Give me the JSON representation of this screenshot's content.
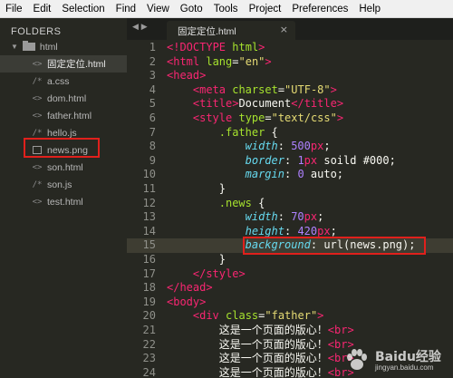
{
  "menu": [
    "File",
    "Edit",
    "Selection",
    "Find",
    "View",
    "Goto",
    "Tools",
    "Project",
    "Preferences",
    "Help"
  ],
  "sidebar": {
    "header": "FOLDERS",
    "folder": "html",
    "files": [
      {
        "icon": "<>",
        "name": "固定定位.html",
        "active": true
      },
      {
        "icon": "/*",
        "name": "a.css"
      },
      {
        "icon": "<>",
        "name": "dom.html"
      },
      {
        "icon": "<>",
        "name": "father.html"
      },
      {
        "icon": "/*",
        "name": "hello.js"
      },
      {
        "icon": "img",
        "name": "news.png",
        "highlighted": true
      },
      {
        "icon": "<>",
        "name": "son.html"
      },
      {
        "icon": "/*",
        "name": "son.js"
      },
      {
        "icon": "<>",
        "name": "test.html"
      }
    ]
  },
  "tab": {
    "title": "固定定位.html",
    "close": "×",
    "nav": "◀ ▶"
  },
  "editor": {
    "current_line": 15,
    "highlighted_line": 15,
    "lines": [
      {
        "n": "1",
        "indent": 0,
        "t": [
          [
            "tag",
            "<!"
          ],
          [
            "kw",
            "DOCTYPE"
          ],
          [
            "plain",
            " "
          ],
          [
            "attr",
            "html"
          ],
          [
            "tag",
            ">"
          ]
        ]
      },
      {
        "n": "2",
        "indent": 0,
        "t": [
          [
            "tag",
            "<html"
          ],
          [
            "plain",
            " "
          ],
          [
            "attr",
            "lang"
          ],
          [
            "plain",
            "="
          ],
          [
            "str",
            "\"en\""
          ],
          [
            "tag",
            ">"
          ]
        ]
      },
      {
        "n": "3",
        "indent": 0,
        "t": [
          [
            "tag",
            "<head>"
          ]
        ]
      },
      {
        "n": "4",
        "indent": 1,
        "t": [
          [
            "tag",
            "<meta"
          ],
          [
            "plain",
            " "
          ],
          [
            "attr",
            "charset"
          ],
          [
            "plain",
            "="
          ],
          [
            "str",
            "\"UTF-8\""
          ],
          [
            "tag",
            ">"
          ]
        ]
      },
      {
        "n": "5",
        "indent": 1,
        "t": [
          [
            "tag",
            "<title>"
          ],
          [
            "plain",
            "Document"
          ],
          [
            "tag",
            "</title>"
          ]
        ]
      },
      {
        "n": "6",
        "indent": 1,
        "t": [
          [
            "tag",
            "<style"
          ],
          [
            "plain",
            " "
          ],
          [
            "attr",
            "type"
          ],
          [
            "plain",
            "="
          ],
          [
            "str",
            "\"text/css\""
          ],
          [
            "tag",
            ">"
          ]
        ]
      },
      {
        "n": "7",
        "indent": 2,
        "t": [
          [
            "sel",
            ".father"
          ],
          [
            "plain",
            " {"
          ]
        ]
      },
      {
        "n": "8",
        "indent": 3,
        "t": [
          [
            "prop",
            "width"
          ],
          [
            "plain",
            ": "
          ],
          [
            "num",
            "500"
          ],
          [
            "unit",
            "px"
          ],
          [
            "plain",
            ";"
          ]
        ]
      },
      {
        "n": "9",
        "indent": 3,
        "t": [
          [
            "prop",
            "border"
          ],
          [
            "plain",
            ": "
          ],
          [
            "num",
            "1"
          ],
          [
            "unit",
            "px"
          ],
          [
            "plain",
            " soild #000;"
          ]
        ]
      },
      {
        "n": "10",
        "indent": 3,
        "t": [
          [
            "prop",
            "margin"
          ],
          [
            "plain",
            ": "
          ],
          [
            "num",
            "0"
          ],
          [
            "plain",
            " auto;"
          ]
        ]
      },
      {
        "n": "11",
        "indent": 2,
        "t": [
          [
            "plain",
            "}"
          ]
        ]
      },
      {
        "n": "12",
        "indent": 2,
        "t": [
          [
            "sel",
            ".news"
          ],
          [
            "plain",
            " {"
          ]
        ]
      },
      {
        "n": "13",
        "indent": 3,
        "t": [
          [
            "prop",
            "width"
          ],
          [
            "plain",
            ": "
          ],
          [
            "num",
            "70"
          ],
          [
            "unit",
            "px"
          ],
          [
            "plain",
            ";"
          ]
        ]
      },
      {
        "n": "14",
        "indent": 3,
        "t": [
          [
            "prop",
            "height"
          ],
          [
            "plain",
            ": "
          ],
          [
            "num",
            "420"
          ],
          [
            "unit",
            "px"
          ],
          [
            "plain",
            ";"
          ]
        ]
      },
      {
        "n": "15",
        "indent": 3,
        "t": [
          [
            "prop",
            "background"
          ],
          [
            "plain",
            ": url(news.png);"
          ]
        ]
      },
      {
        "n": "16",
        "indent": 2,
        "t": [
          [
            "plain",
            "}"
          ]
        ]
      },
      {
        "n": "17",
        "indent": 1,
        "t": [
          [
            "tag",
            "</style>"
          ]
        ]
      },
      {
        "n": "18",
        "indent": 0,
        "t": [
          [
            "tag",
            "</head>"
          ]
        ]
      },
      {
        "n": "19",
        "indent": 0,
        "t": [
          [
            "tag",
            "<body>"
          ]
        ]
      },
      {
        "n": "20",
        "indent": 1,
        "t": [
          [
            "tag",
            "<div"
          ],
          [
            "plain",
            " "
          ],
          [
            "attr",
            "class"
          ],
          [
            "plain",
            "="
          ],
          [
            "str",
            "\"father\""
          ],
          [
            "tag",
            ">"
          ]
        ]
      },
      {
        "n": "21",
        "indent": 2,
        "t": [
          [
            "plain",
            "这是一个页面的版心！"
          ],
          [
            "tag",
            "<br>"
          ]
        ]
      },
      {
        "n": "22",
        "indent": 2,
        "t": [
          [
            "plain",
            "这是一个页面的版心！"
          ],
          [
            "tag",
            "<br>"
          ]
        ]
      },
      {
        "n": "23",
        "indent": 2,
        "t": [
          [
            "plain",
            "这是一个页面的版心！"
          ],
          [
            "tag",
            "<br>"
          ]
        ]
      },
      {
        "n": "24",
        "indent": 2,
        "t": [
          [
            "plain",
            "这是一个页面的版心！"
          ],
          [
            "tag",
            "<br>"
          ]
        ]
      }
    ]
  },
  "watermark": {
    "text": "Baidu经验",
    "url": "jingyan.baidu.com"
  },
  "colors": {
    "highlight_box": "#e0201c",
    "editor_bg": "#272822",
    "menubar_bg": "#f0f0f0"
  }
}
